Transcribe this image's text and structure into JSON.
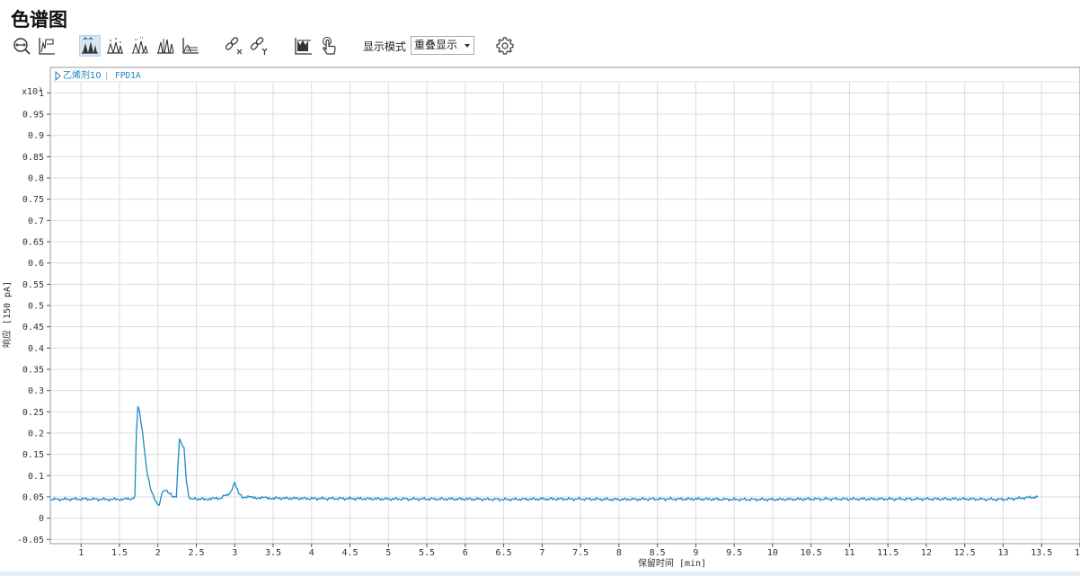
{
  "page": {
    "title": "色谱图"
  },
  "toolbar": {
    "buttons": [
      {
        "icon": "zoom-horizontal-icon",
        "active": false
      },
      {
        "icon": "baseline-icon",
        "active": false
      },
      {
        "icon": "peaks-filled-icon",
        "active": true
      },
      {
        "icon": "peaks-labeled-icon",
        "active": false
      },
      {
        "icon": "peaks-dashed-icon",
        "active": false
      },
      {
        "icon": "peaks-split-icon",
        "active": false
      },
      {
        "icon": "peaks-stacked-icon",
        "active": false
      },
      {
        "icon": "link-x-icon",
        "active": false
      },
      {
        "icon": "link-y-icon",
        "active": false
      },
      {
        "icon": "integration-icon",
        "active": false
      },
      {
        "icon": "hand-pointer-icon",
        "active": false
      },
      {
        "icon": "gear-icon",
        "active": false
      }
    ],
    "mode_label": "显示模式",
    "mode_value": "重叠显示"
  },
  "colors": {
    "trace": "#1a8ac6",
    "grid": "#dcdcdc",
    "axis": "#555555",
    "legend": "#1a7fc4"
  },
  "chart_data": {
    "type": "line",
    "legend": {
      "sample": "乙烯剂10",
      "detector": "FPD1A"
    },
    "xlabel": "保留时间 [min]",
    "ylabel": "响应 [150 pA]",
    "y_multiplier": "x10²",
    "xlim": [
      0.6,
      14
    ],
    "ylim": [
      -0.06,
      1.06
    ],
    "x_ticks": [
      1,
      1.5,
      2,
      2.5,
      3,
      3.5,
      4,
      4.5,
      5,
      5.5,
      6,
      6.5,
      7,
      7.5,
      8,
      8.5,
      9,
      9.5,
      10,
      10.5,
      11,
      11.5,
      12,
      12.5,
      13,
      13.5,
      14
    ],
    "x_tick_labels": [
      "1",
      "1.5",
      "2",
      "2.5",
      "3",
      "3.5",
      "4",
      "4.5",
      "5",
      "5.5",
      "6",
      "6.5",
      "7",
      "7.5",
      "8",
      "8.5",
      "9",
      "9.5",
      "10",
      "10.5",
      "11",
      "11.5",
      "12",
      "12.5",
      "13",
      "13.5",
      "14"
    ],
    "y_ticks": [
      1,
      0.95,
      0.9,
      0.85,
      0.8,
      0.75,
      0.7,
      0.65,
      0.6,
      0.55,
      0.5,
      0.45,
      0.4,
      0.35,
      0.3,
      0.25,
      0.2,
      0.15,
      0.1,
      0.05,
      0,
      -0.05
    ],
    "y_tick_labels": [
      "1",
      "0.95",
      "0.9",
      "0.85",
      "0.8",
      "0.75",
      "0.7",
      "0.65",
      "0.6",
      "0.55",
      "0.5",
      "0.45",
      "0.4",
      "0.35",
      "0.3",
      "0.25",
      "0.2",
      "0.15",
      "0.1",
      "0.05",
      "0",
      "-0.05"
    ],
    "grid": true,
    "series": [
      {
        "x": [
          0.6,
          1.0,
          1.4,
          1.65,
          1.7,
          1.72,
          1.74,
          1.76,
          1.8,
          1.85,
          1.9,
          1.95,
          1.98,
          2.02,
          2.05,
          2.1,
          2.15,
          2.2,
          2.24,
          2.26,
          2.28,
          2.3,
          2.34,
          2.37,
          2.4,
          2.45,
          2.6,
          2.8,
          2.95,
          3.0,
          3.05,
          3.1,
          3.3,
          3.5,
          4.0,
          4.5,
          5.0,
          5.5,
          6.0,
          6.5,
          7.0,
          7.5,
          8.0,
          8.5,
          9.0,
          9.5,
          10.0,
          10.5,
          11.0,
          11.5,
          12.0,
          12.5,
          13.0,
          13.45
        ],
        "y": [
          0.044,
          0.045,
          0.044,
          0.045,
          0.05,
          0.2,
          0.262,
          0.25,
          0.2,
          0.12,
          0.07,
          0.05,
          0.035,
          0.028,
          0.06,
          0.065,
          0.06,
          0.048,
          0.05,
          0.12,
          0.188,
          0.175,
          0.165,
          0.09,
          0.05,
          0.045,
          0.045,
          0.046,
          0.06,
          0.085,
          0.058,
          0.05,
          0.048,
          0.047,
          0.046,
          0.046,
          0.045,
          0.045,
          0.045,
          0.044,
          0.045,
          0.045,
          0.044,
          0.045,
          0.045,
          0.044,
          0.044,
          0.045,
          0.045,
          0.045,
          0.045,
          0.045,
          0.044,
          0.05
        ]
      }
    ]
  }
}
